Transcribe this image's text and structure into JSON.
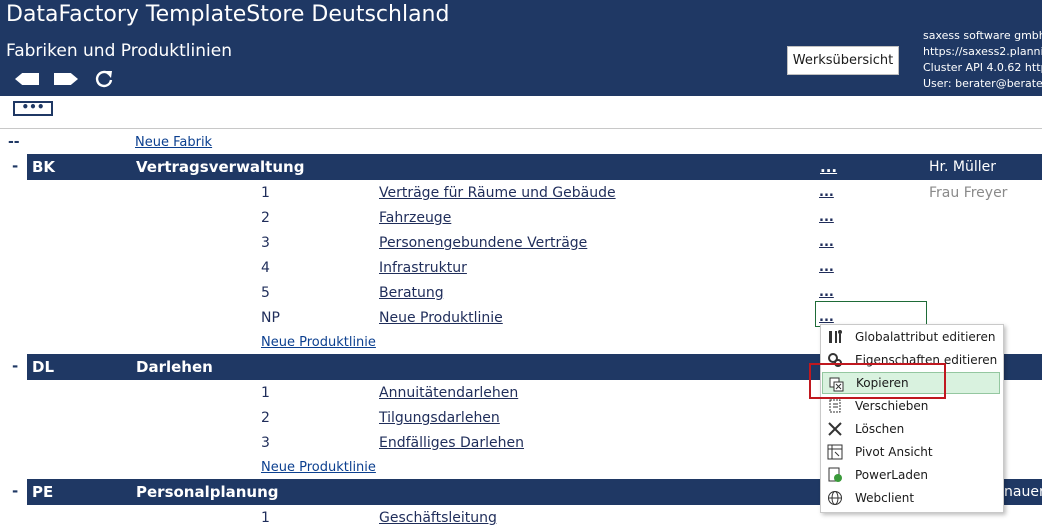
{
  "header": {
    "app_title": "DataFactory TemplateStore Deutschland",
    "subtitle": "Fabriken und Produktlinien",
    "works_button": "Werksübersicht",
    "info_lines": [
      "saxess software gmbh",
      "https://saxess2.planni",
      "Cluster API 4.0.62 http",
      "User: berater@berate"
    ]
  },
  "toolbar": {
    "more_label": "•••"
  },
  "top": {
    "dash": "--",
    "new_factory": "Neue Fabrik"
  },
  "factories": [
    {
      "code": "BK",
      "name": "Vertragsverwaltung",
      "dots": "...",
      "owner": "Hr. Müller",
      "owner2": "Frau Freyer",
      "lines": [
        {
          "num": "1",
          "name": "Verträge für Räume und Gebäude",
          "dots": "..."
        },
        {
          "num": "2",
          "name": "Fahrzeuge",
          "dots": "..."
        },
        {
          "num": "3",
          "name": "Personengebundene Verträge",
          "dots": "..."
        },
        {
          "num": "4",
          "name": "Infrastruktur",
          "dots": "..."
        },
        {
          "num": "5",
          "name": "Beratung",
          "dots": "..."
        },
        {
          "num": "NP",
          "name": "Neue Produktlinie",
          "dots": "..."
        }
      ],
      "new_line": "Neue Produktlinie"
    },
    {
      "code": "DL",
      "name": "Darlehen",
      "lines": [
        {
          "num": "1",
          "name": "Annuitätendarlehen"
        },
        {
          "num": "2",
          "name": "Tilgungsdarlehen"
        },
        {
          "num": "3",
          "name": "Endfälliges Darlehen"
        }
      ],
      "new_line": "Neue Produktlinie"
    },
    {
      "code": "PE",
      "name": "Personalplanung",
      "owner": "nauer",
      "lines": [
        {
          "num": "1",
          "name": "Geschäftsleitung"
        }
      ]
    }
  ],
  "context_menu": [
    {
      "label": "Globalattribut editieren",
      "icon": "tools-icon"
    },
    {
      "label": "Eigenschaften editieren",
      "icon": "gears-icon"
    },
    {
      "label": "Kopieren",
      "icon": "copy-icon",
      "highlighted": true
    },
    {
      "label": "Verschieben",
      "icon": "move-icon"
    },
    {
      "label": "Löschen",
      "icon": "delete-icon"
    },
    {
      "label": "Pivot Ansicht",
      "icon": "pivot-icon"
    },
    {
      "label": "PowerLaden",
      "icon": "power-load-icon"
    },
    {
      "label": "Webclient",
      "icon": "globe-icon"
    }
  ],
  "colors": {
    "header_bg": "#1f3864",
    "highlight": "#d9f2df",
    "red_outline": "#c0181f"
  }
}
